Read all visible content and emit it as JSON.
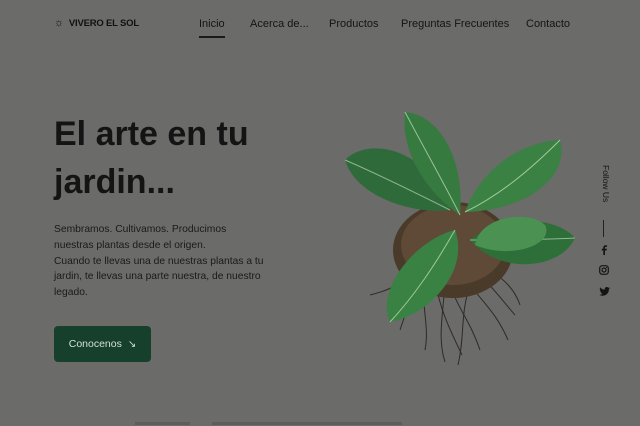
{
  "brand": {
    "name": "VIVERO EL SOL",
    "logo_icon": "sun-icon"
  },
  "nav": {
    "items": [
      {
        "label": "Inicio",
        "active": true
      },
      {
        "label": "Acerca de...",
        "active": false
      },
      {
        "label": "Productos",
        "active": false
      },
      {
        "label": "Preguntas Frecuentes",
        "active": false
      },
      {
        "label": "Contacto",
        "active": false
      }
    ]
  },
  "hero": {
    "title_line1": "El arte en tu",
    "title_line2": "jardin...",
    "paragraph_line1": "Sembramos. Cultivamos. Producimos",
    "paragraph_line2": "nuestras plantas desde el origen.",
    "paragraph_line3": "Cuando te llevas una de nuestras plantas a tu",
    "paragraph_line4": "jardin, te llevas una parte nuestra, de nuestro",
    "paragraph_line5": "legado.",
    "cta_label": "Conocenos",
    "cta_icon": "arrow-down-right-icon"
  },
  "social": {
    "label": "Follow Us",
    "icons": [
      "facebook-icon",
      "instagram-icon",
      "twitter-icon"
    ]
  },
  "colors": {
    "background": "#6b6b69",
    "button": "#17402c",
    "button_text": "#cfe1d2",
    "text": "#141414"
  }
}
